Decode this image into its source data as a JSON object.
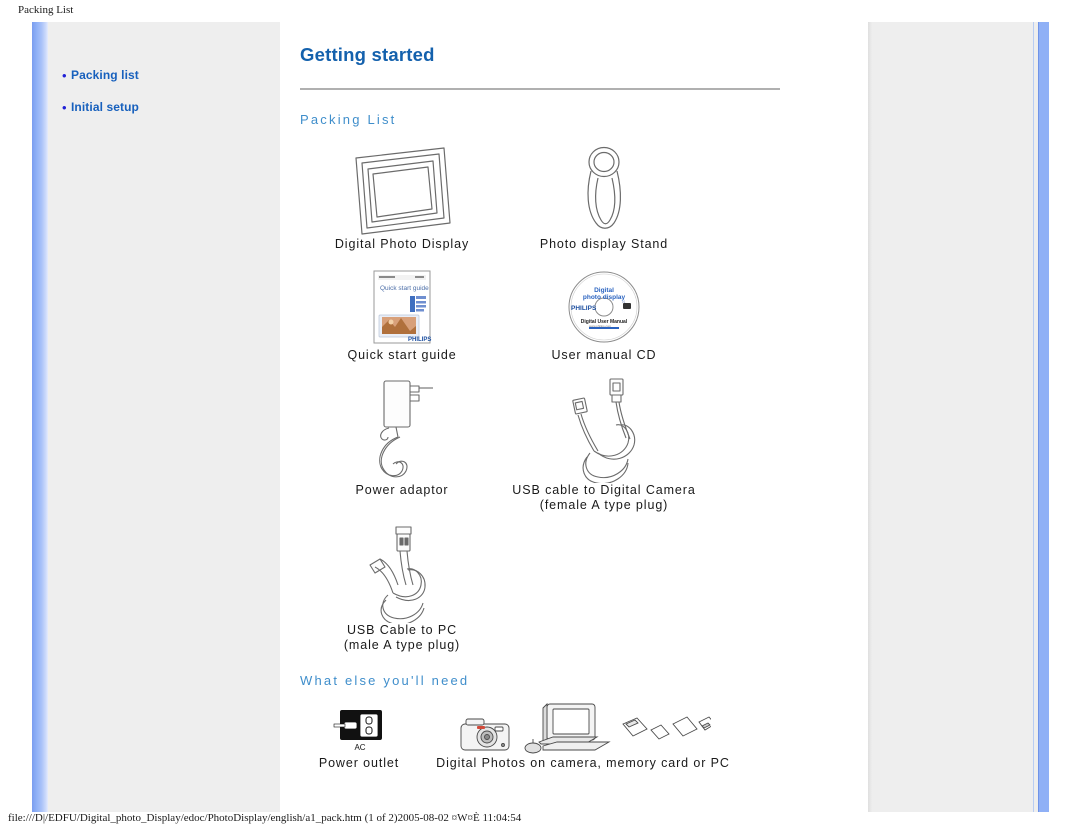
{
  "print": {
    "header_title": "Packing List",
    "footer": "file:///D|/EDFU/Digital_photo_Display/edoc/PhotoDisplay/english/a1_pack.htm (1 of 2)2005-08-02 ¤W¤È 11:04:54"
  },
  "sidebar": {
    "bullet": "•",
    "items": [
      {
        "label": "Packing list"
      },
      {
        "label": "Initial setup"
      }
    ]
  },
  "main": {
    "title": "Getting started",
    "section_packing": "Packing List",
    "section_need": "What else you'll need",
    "packing_items": [
      {
        "caption": "Digital Photo Display",
        "icon": "photo-frame-icon"
      },
      {
        "caption": "Photo display Stand",
        "icon": "display-stand-icon"
      },
      {
        "caption": "Quick start guide",
        "icon": "booklet-icon"
      },
      {
        "caption": "User manual CD",
        "icon": "cd-disc-icon"
      },
      {
        "caption": "Power adaptor",
        "icon": "power-adaptor-icon"
      },
      {
        "caption": "USB cable to Digital Camera\n(female A type plug)",
        "caption_line1": "USB cable to Digital Camera",
        "caption_line2": "(female A type plug)",
        "icon": "usb-cable-camera-icon"
      },
      {
        "caption_line1": "USB Cable to PC",
        "caption_line2": "(male A type plug)",
        "icon": "usb-cable-pc-icon"
      }
    ],
    "need_items": [
      {
        "caption": "Power outlet",
        "icon": "power-outlet-icon",
        "badge": "AC"
      },
      {
        "caption": "Digital Photos on camera, memory card or PC",
        "icon": "camera-pc-cards-icon"
      }
    ],
    "booklet": {
      "title": "Quick start guide",
      "brand": "PHILIPS"
    },
    "cd": {
      "brand": "PHILIPS",
      "line1": "Digital",
      "line2": "photo display",
      "subtitle": "Digital User Manual"
    }
  },
  "colors": {
    "heading_blue": "#1461ad",
    "section_blue": "#3f8ecb",
    "menu_blue": "#1760bd",
    "bullet_blue": "#2121d6",
    "rail_blue": "#8fb0f6",
    "panel_grey": "#eeeeee",
    "line_grey": "#b0b0b0"
  }
}
